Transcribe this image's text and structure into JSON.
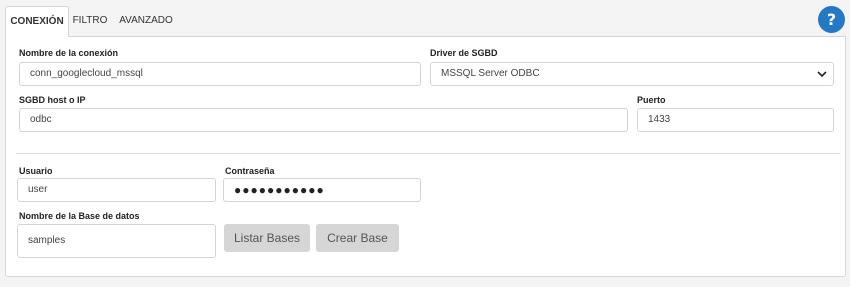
{
  "tabs": [
    "CONEXIÓN",
    "FILTRO",
    "AVANZADO"
  ],
  "help_label": "?",
  "form": {
    "connection_name": {
      "label": "Nombre de la conexión",
      "value": "conn_googlecloud_mssql"
    },
    "driver": {
      "label": "Driver de SGBD",
      "value": "MSSQL Server ODBC"
    },
    "host": {
      "label": "SGBD host o IP",
      "value": "odbc"
    },
    "port": {
      "label": "Puerto",
      "value": "1433"
    },
    "user": {
      "label": "Usuario",
      "value": "user"
    },
    "password": {
      "label": "Contraseña",
      "value": "●●●●●●●●●●●"
    },
    "database": {
      "label": "Nombre de la Base de datos",
      "value": "samples"
    }
  },
  "buttons": {
    "list": "Listar Bases",
    "create": "Crear Base"
  },
  "colors": {
    "accent": "#2478c4",
    "button_bg": "#d6d6d6"
  }
}
